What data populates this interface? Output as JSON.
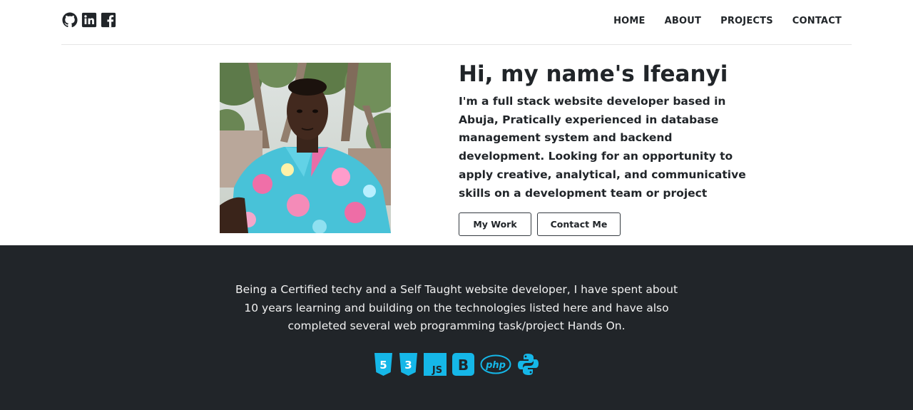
{
  "nav": {
    "social_icons": [
      "github-icon",
      "linkedin-icon",
      "facebook-icon"
    ],
    "links": [
      "HOME",
      "ABOUT",
      "PROJECTS",
      "CONTACT"
    ]
  },
  "hero": {
    "title": "Hi, my name's Ifeanyi",
    "description": "I'm a full stack website developer based in Abuja, Pratically experienced in database management system and backend development. Looking for an opportunity to apply creative, analytical, and communicative skills on a development team or project",
    "buttons": {
      "work": "My Work",
      "contact": "Contact Me"
    }
  },
  "skills": {
    "text": "Being a Certified techy and a Self Taught website developer, I have spent about 10 years learning and building on the technologies listed here and have also completed several web programming task/project Hands On.",
    "icons": [
      "html5-icon",
      "css3-icon",
      "javascript-icon",
      "bootstrap-icon",
      "php-icon",
      "python-icon"
    ],
    "icon_labels": {
      "html": "5",
      "css": "3",
      "js": "JS",
      "bootstrap": "B",
      "php": "php"
    }
  },
  "colors": {
    "dark_bg": "#212529",
    "accent": "#15b7e8",
    "text": "#212529"
  }
}
